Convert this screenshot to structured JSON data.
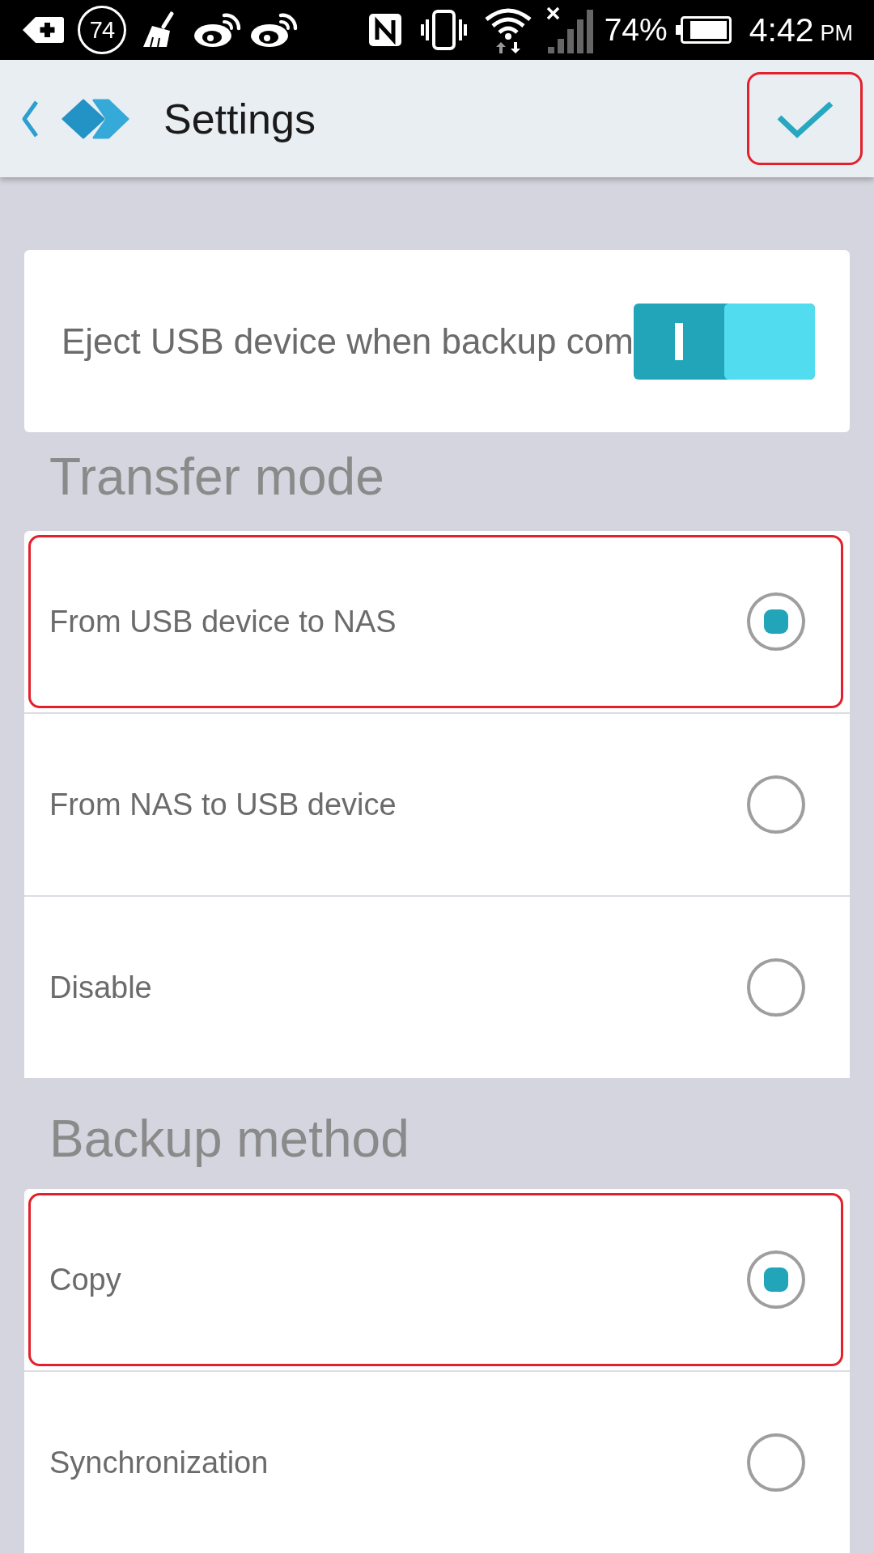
{
  "status_bar": {
    "notification_count": "74",
    "battery": "74%",
    "time": "4:42",
    "meridiem": "PM"
  },
  "header": {
    "title": "Settings",
    "confirm": {
      "highlighted": true
    }
  },
  "eject_card": {
    "label": "Eject USB device when backup com",
    "on": true
  },
  "sections": [
    {
      "heading": "Transfer mode",
      "options": [
        {
          "label": "From USB device to NAS",
          "selected": true,
          "highlighted": true
        },
        {
          "label": "From NAS to USB device",
          "selected": false,
          "highlighted": false
        },
        {
          "label": "Disable",
          "selected": false,
          "highlighted": false
        }
      ]
    },
    {
      "heading": "Backup method",
      "options": [
        {
          "label": "Copy",
          "selected": true,
          "highlighted": true
        },
        {
          "label": "Synchronization",
          "selected": false,
          "highlighted": false
        }
      ]
    }
  ]
}
